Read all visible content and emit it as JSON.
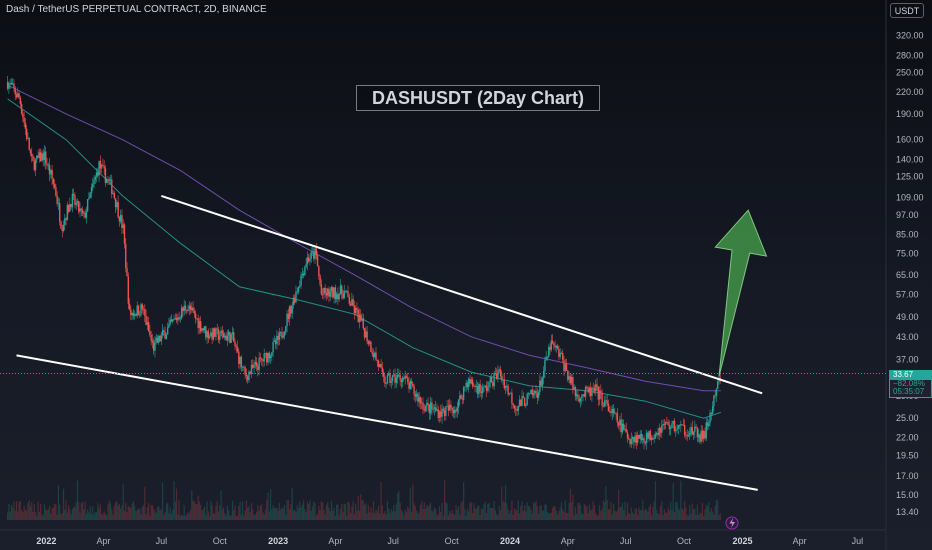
{
  "header": {
    "symbol_line": "Dash / TetherUS PERPETUAL CONTRACT, 2D, BINANCE",
    "currency": "USDT"
  },
  "title": "DASHUSDT (2Day Chart)",
  "price_tag": {
    "price": "33.67",
    "change": "−82.08%",
    "countdown": "05:35:07"
  },
  "colors": {
    "background": "#131722",
    "candle_up": "#26a69a",
    "candle_down": "#ef5350",
    "ma_fast": "#26a69a",
    "ma_slow": "#7e57c2",
    "trendline": "#ffffff",
    "arrow": "#4caf50"
  },
  "chart_data": {
    "type": "candlestick",
    "y_scale": "log",
    "y_axis_ticks": [
      "320.00",
      "280.00",
      "250.00",
      "220.00",
      "190.00",
      "160.00",
      "140.00",
      "125.00",
      "109.00",
      "97.00",
      "85.00",
      "75.00",
      "65.00",
      "57.00",
      "49.00",
      "43.00",
      "37.00",
      "29.00",
      "25.00",
      "22.00",
      "19.50",
      "17.00",
      "15.00",
      "13.40"
    ],
    "x_axis_labels": [
      "2022",
      "Apr",
      "Jul",
      "Oct",
      "2023",
      "Apr",
      "Jul",
      "Oct",
      "2024",
      "Apr",
      "Jul",
      "Oct",
      "2025",
      "Apr",
      "Jul"
    ],
    "ylim": [
      12.6,
      360
    ],
    "xlim": [
      "2021-10-20",
      "2025-08-15"
    ],
    "price_path": [
      [
        "2021-11-01",
        235
      ],
      [
        "2021-11-20",
        210
      ],
      [
        "2021-12-10",
        135
      ],
      [
        "2021-12-28",
        145
      ],
      [
        "2022-01-15",
        115
      ],
      [
        "2022-01-25",
        90
      ],
      [
        "2022-02-10",
        108
      ],
      [
        "2022-03-01",
        95
      ],
      [
        "2022-03-25",
        135
      ],
      [
        "2022-04-15",
        115
      ],
      [
        "2022-05-02",
        88
      ],
      [
        "2022-05-12",
        50
      ],
      [
        "2022-06-01",
        52
      ],
      [
        "2022-06-18",
        40
      ],
      [
        "2022-07-10",
        45
      ],
      [
        "2022-08-10",
        53
      ],
      [
        "2022-09-10",
        44
      ],
      [
        "2022-10-20",
        43
      ],
      [
        "2022-11-10",
        33
      ],
      [
        "2022-12-15",
        38
      ],
      [
        "2023-01-05",
        43
      ],
      [
        "2023-01-25",
        55
      ],
      [
        "2023-02-15",
        72
      ],
      [
        "2023-03-01",
        75
      ],
      [
        "2023-03-10",
        57
      ],
      [
        "2023-04-15",
        58
      ],
      [
        "2023-05-10",
        48
      ],
      [
        "2023-06-10",
        35
      ],
      [
        "2023-06-15",
        32
      ],
      [
        "2023-07-15",
        33
      ],
      [
        "2023-08-20",
        27
      ],
      [
        "2023-09-15",
        26
      ],
      [
        "2023-10-10",
        27
      ],
      [
        "2023-10-25",
        32
      ],
      [
        "2023-11-20",
        30
      ],
      [
        "2023-12-15",
        34
      ],
      [
        "2024-01-10",
        27
      ],
      [
        "2024-02-15",
        30
      ],
      [
        "2024-03-05",
        41
      ],
      [
        "2024-03-20",
        38
      ],
      [
        "2024-04-15",
        29
      ],
      [
        "2024-05-15",
        30
      ],
      [
        "2024-06-15",
        25
      ],
      [
        "2024-07-05",
        22
      ],
      [
        "2024-08-05",
        22
      ],
      [
        "2024-09-01",
        24
      ],
      [
        "2024-10-10",
        23
      ],
      [
        "2024-11-01",
        22
      ],
      [
        "2024-11-15",
        27
      ],
      [
        "2024-11-28",
        33.67
      ]
    ],
    "current_price": 33.67,
    "series": [
      {
        "values": [
          [
            "2021-11-01",
            210
          ],
          [
            "2022-02-01",
            160
          ],
          [
            "2022-05-01",
            110
          ],
          [
            "2022-08-01",
            80
          ],
          [
            "2022-11-01",
            60
          ],
          [
            "2023-02-01",
            55
          ],
          [
            "2023-05-01",
            50
          ],
          [
            "2023-08-01",
            40
          ],
          [
            "2023-11-01",
            34
          ],
          [
            "2024-02-01",
            31
          ],
          [
            "2024-05-01",
            30
          ],
          [
            "2024-08-01",
            28
          ],
          [
            "2024-11-01",
            25
          ],
          [
            "2024-11-28",
            26
          ]
        ]
      },
      {
        "values": [
          [
            "2021-11-01",
            230
          ],
          [
            "2022-02-01",
            190
          ],
          [
            "2022-05-01",
            160
          ],
          [
            "2022-08-01",
            130
          ],
          [
            "2022-11-01",
            100
          ],
          [
            "2023-02-01",
            80
          ],
          [
            "2023-05-01",
            65
          ],
          [
            "2023-08-01",
            52
          ],
          [
            "2023-11-01",
            43
          ],
          [
            "2024-02-01",
            38
          ],
          [
            "2024-05-01",
            35
          ],
          [
            "2024-08-01",
            32
          ],
          [
            "2024-11-01",
            30
          ],
          [
            "2024-11-28",
            30
          ]
        ]
      }
    ],
    "trendlines": [
      {
        "name": "upper",
        "from": [
          "2022-07-01",
          110
        ],
        "to": [
          "2025-02-01",
          29.5
        ]
      },
      {
        "name": "lower",
        "from": [
          "2021-11-15",
          38
        ],
        "to": [
          "2025-01-25",
          15.5
        ]
      }
    ],
    "arrow": {
      "from": [
        "2024-11-25",
        33
      ],
      "to": [
        "2025-01-10",
        100
      ]
    }
  }
}
